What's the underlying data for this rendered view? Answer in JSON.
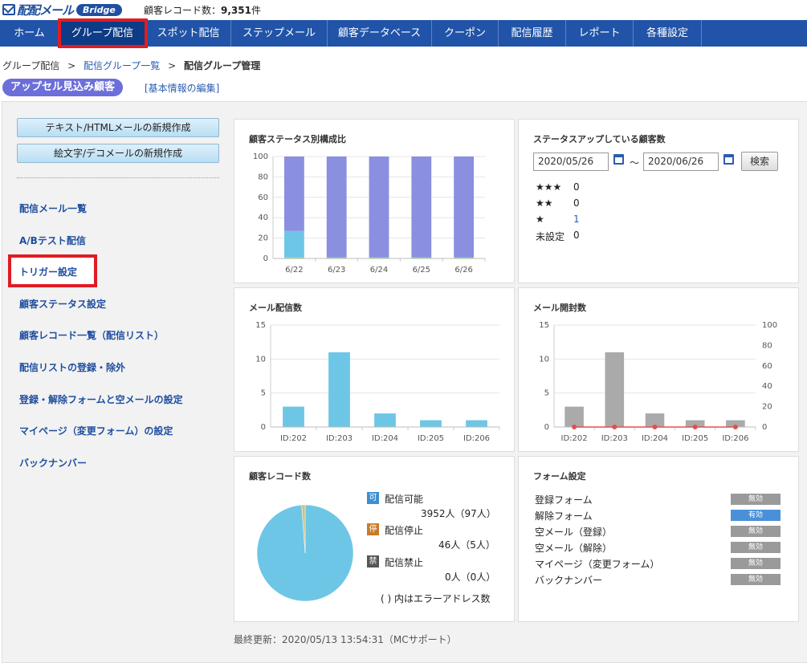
{
  "header": {
    "logo_name": "配配メール",
    "logo_badge": "Bridge",
    "record_count_label": "顧客レコード数：",
    "record_count_value": "9,351",
    "record_count_unit": "件"
  },
  "nav": [
    {
      "label": "ホーム",
      "active": false
    },
    {
      "label": "グループ配信",
      "active": true
    },
    {
      "label": "スポット配信",
      "active": false
    },
    {
      "label": "ステップメール",
      "active": false
    },
    {
      "label": "顧客データベース",
      "active": false
    },
    {
      "label": "クーポン",
      "active": false
    },
    {
      "label": "配信履歴",
      "active": false
    },
    {
      "label": "レポート",
      "active": false
    },
    {
      "label": "各種設定",
      "active": false
    }
  ],
  "breadcrumb": {
    "item1": "グループ配信",
    "sep": ">",
    "item2": "配信グループ一覧",
    "current": "配信グループ管理"
  },
  "group": {
    "title": "アップセル見込み顧客",
    "edit_link": "[基本情報の編集]"
  },
  "sidebar": {
    "create_text_button": "テキスト/HTMLメールの新規作成",
    "create_deco_button": "絵文字/デコメールの新規作成",
    "menu": [
      "配信メール一覧",
      "A/Bテスト配信",
      "トリガー設定",
      "顧客ステータス設定",
      "顧客レコード一覧（配信リスト）",
      "配信リストの登録・除外",
      "登録・解除フォームと空メールの設定",
      "マイページ（変更フォーム）の設定",
      "バックナンバー"
    ]
  },
  "status_chart_title": "顧客ステータス別構成比",
  "status_up": {
    "title": "ステータスアップしている顧客数",
    "date_from": "2020/05/26",
    "tilde": "～",
    "date_to": "2020/06/26",
    "search_button": "検索",
    "rows": [
      {
        "label": "★★★",
        "value": "0"
      },
      {
        "label": "★★",
        "value": "0"
      },
      {
        "label": "★",
        "value": "1"
      },
      {
        "label": "未設定",
        "value": "0"
      }
    ]
  },
  "mail_sent_title": "メール配信数",
  "mail_open_title": "メール開封数",
  "records": {
    "title": "顧客レコード数",
    "items": [
      {
        "badge": "可",
        "label": "配信可能",
        "value": "3952人（97人）",
        "color": "#3d8fd1"
      },
      {
        "badge": "停",
        "label": "配信停止",
        "value": "46人（5人）",
        "color": "#c77b2b"
      },
      {
        "badge": "禁",
        "label": "配信禁止",
        "value": "0人（0人）",
        "color": "#555555"
      }
    ],
    "note": "( ) 内はエラーアドレス数"
  },
  "form_settings": {
    "title": "フォーム設定",
    "rows": [
      {
        "label": "登録フォーム",
        "status": "無効",
        "color": "#9a9a9a"
      },
      {
        "label": "解除フォーム",
        "status": "有効",
        "color": "#4a90d9"
      },
      {
        "label": "空メール（登録）",
        "status": "無効",
        "color": "#9a9a9a"
      },
      {
        "label": "空メール（解除）",
        "status": "無効",
        "color": "#9a9a9a"
      },
      {
        "label": "マイページ（変更フォーム）",
        "status": "無効",
        "color": "#9a9a9a"
      },
      {
        "label": "バックナンバー",
        "status": "無効",
        "color": "#9a9a9a"
      }
    ]
  },
  "footer": "最終更新：2020/05/13 13:54:31（MCサポート）",
  "chart_data": [
    {
      "type": "bar",
      "title": "顧客ステータス別構成比",
      "stacked": true,
      "categories": [
        "6/22",
        "6/23",
        "6/24",
        "6/25",
        "6/26"
      ],
      "series": [
        {
          "values": [
            1,
            1,
            1,
            1,
            1
          ],
          "color": "#7fd87f"
        },
        {
          "values": [
            26,
            0,
            0,
            0,
            0
          ],
          "color": "#6ec6e6"
        },
        {
          "values": [
            73,
            99,
            99,
            99,
            99
          ],
          "color": "#8a8fe0"
        }
      ],
      "ylim": [
        0,
        100
      ],
      "yticks": [
        0,
        20,
        40,
        60,
        80,
        100
      ]
    },
    {
      "type": "bar",
      "title": "メール配信数",
      "categories": [
        "ID:202",
        "ID:203",
        "ID:204",
        "ID:205",
        "ID:206"
      ],
      "values": [
        3,
        11,
        2,
        1,
        1
      ],
      "color": "#6ec6e6",
      "ylim": [
        0,
        15
      ],
      "yticks": [
        0,
        5,
        10,
        15
      ]
    },
    {
      "type": "bar",
      "title": "メール開封数",
      "categories": [
        "ID:202",
        "ID:203",
        "ID:204",
        "ID:205",
        "ID:206"
      ],
      "values": [
        3,
        11,
        2,
        1,
        1
      ],
      "line_values": [
        0,
        0,
        0,
        0,
        0
      ],
      "color": "#aaaaaa",
      "line_color": "#e05050",
      "ylim": [
        0,
        15
      ],
      "yticks": [
        0,
        5,
        10,
        15
      ],
      "y2lim": [
        0,
        100
      ],
      "y2ticks": [
        0,
        20,
        40,
        60,
        80,
        100
      ]
    },
    {
      "type": "pie",
      "title": "顧客レコード数",
      "labels": [
        "配信可能",
        "配信停止",
        "配信禁止"
      ],
      "values": [
        3952,
        46,
        0
      ],
      "colors": [
        "#6ec6e6",
        "#c8c48a",
        "#555555"
      ]
    }
  ]
}
